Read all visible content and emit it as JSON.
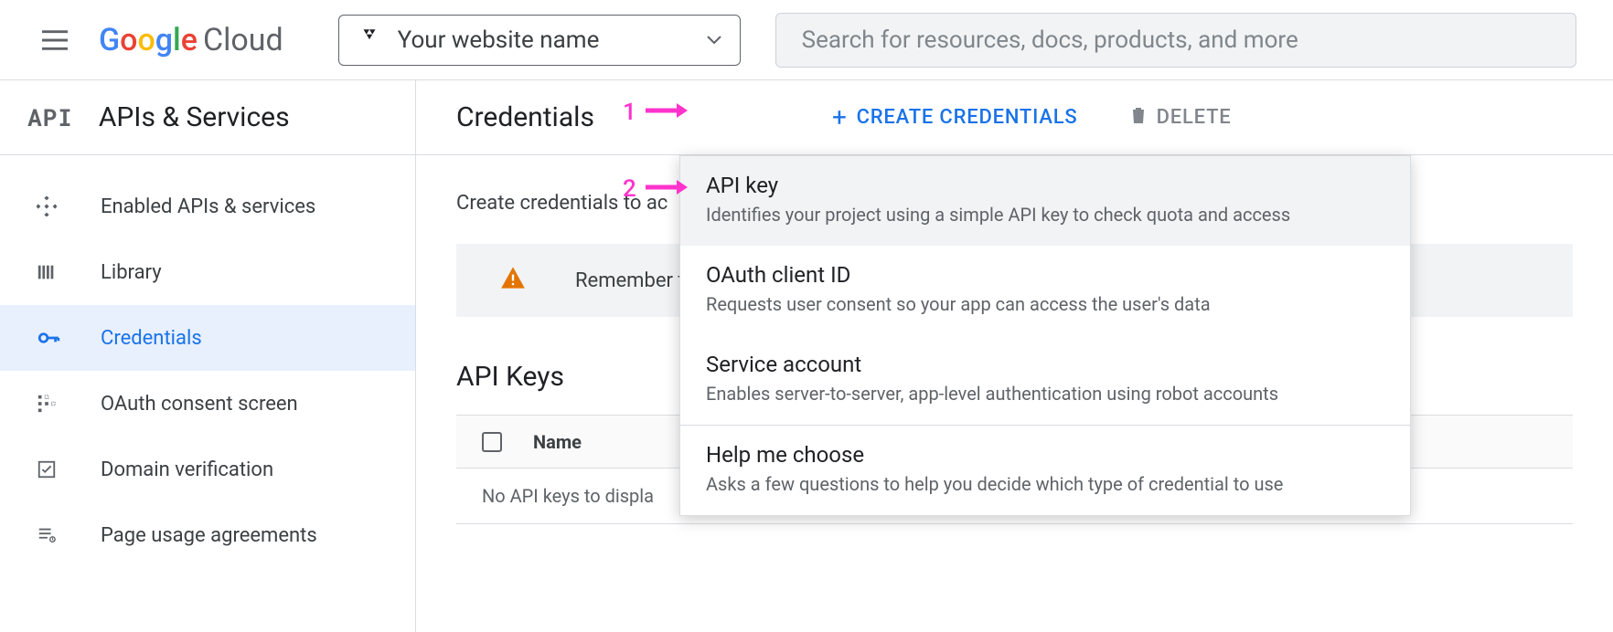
{
  "header": {
    "logo_text": "Google",
    "logo_suffix": "Cloud",
    "project_name": "Your website name",
    "search_placeholder": "Search for resources, docs, products, and more"
  },
  "sidebar": {
    "api_badge": "API",
    "title": "APIs & Services",
    "items": [
      {
        "label": "Enabled APIs & services",
        "icon": "diamond-grid-icon"
      },
      {
        "label": "Library",
        "icon": "library-icon"
      },
      {
        "label": "Credentials",
        "icon": "key-icon"
      },
      {
        "label": "OAuth consent screen",
        "icon": "consent-icon"
      },
      {
        "label": "Domain verification",
        "icon": "check-square-icon"
      },
      {
        "label": "Page usage agreements",
        "icon": "agreement-icon"
      }
    ],
    "active_index": 2
  },
  "main": {
    "title": "Credentials",
    "create_label": "CREATE CREDENTIALS",
    "delete_label": "DELETE",
    "intro_text": "Create credentials to ac",
    "warning_text": "Remember t",
    "section_title": "API Keys",
    "table": {
      "columns": [
        "Name"
      ],
      "empty_text": "No API keys to displa"
    }
  },
  "dropdown": {
    "items": [
      {
        "title": "API key",
        "desc": "Identifies your project using a simple API key to check quota and access"
      },
      {
        "title": "OAuth client ID",
        "desc": "Requests user consent so your app can access the user's data"
      },
      {
        "title": "Service account",
        "desc": "Enables server-to-server, app-level authentication using robot accounts"
      },
      {
        "title": "Help me choose",
        "desc": "Asks a few questions to help you decide which type of credential to use"
      }
    ],
    "hover_index": 0
  },
  "annotations": {
    "step1": "1",
    "step2": "2"
  }
}
